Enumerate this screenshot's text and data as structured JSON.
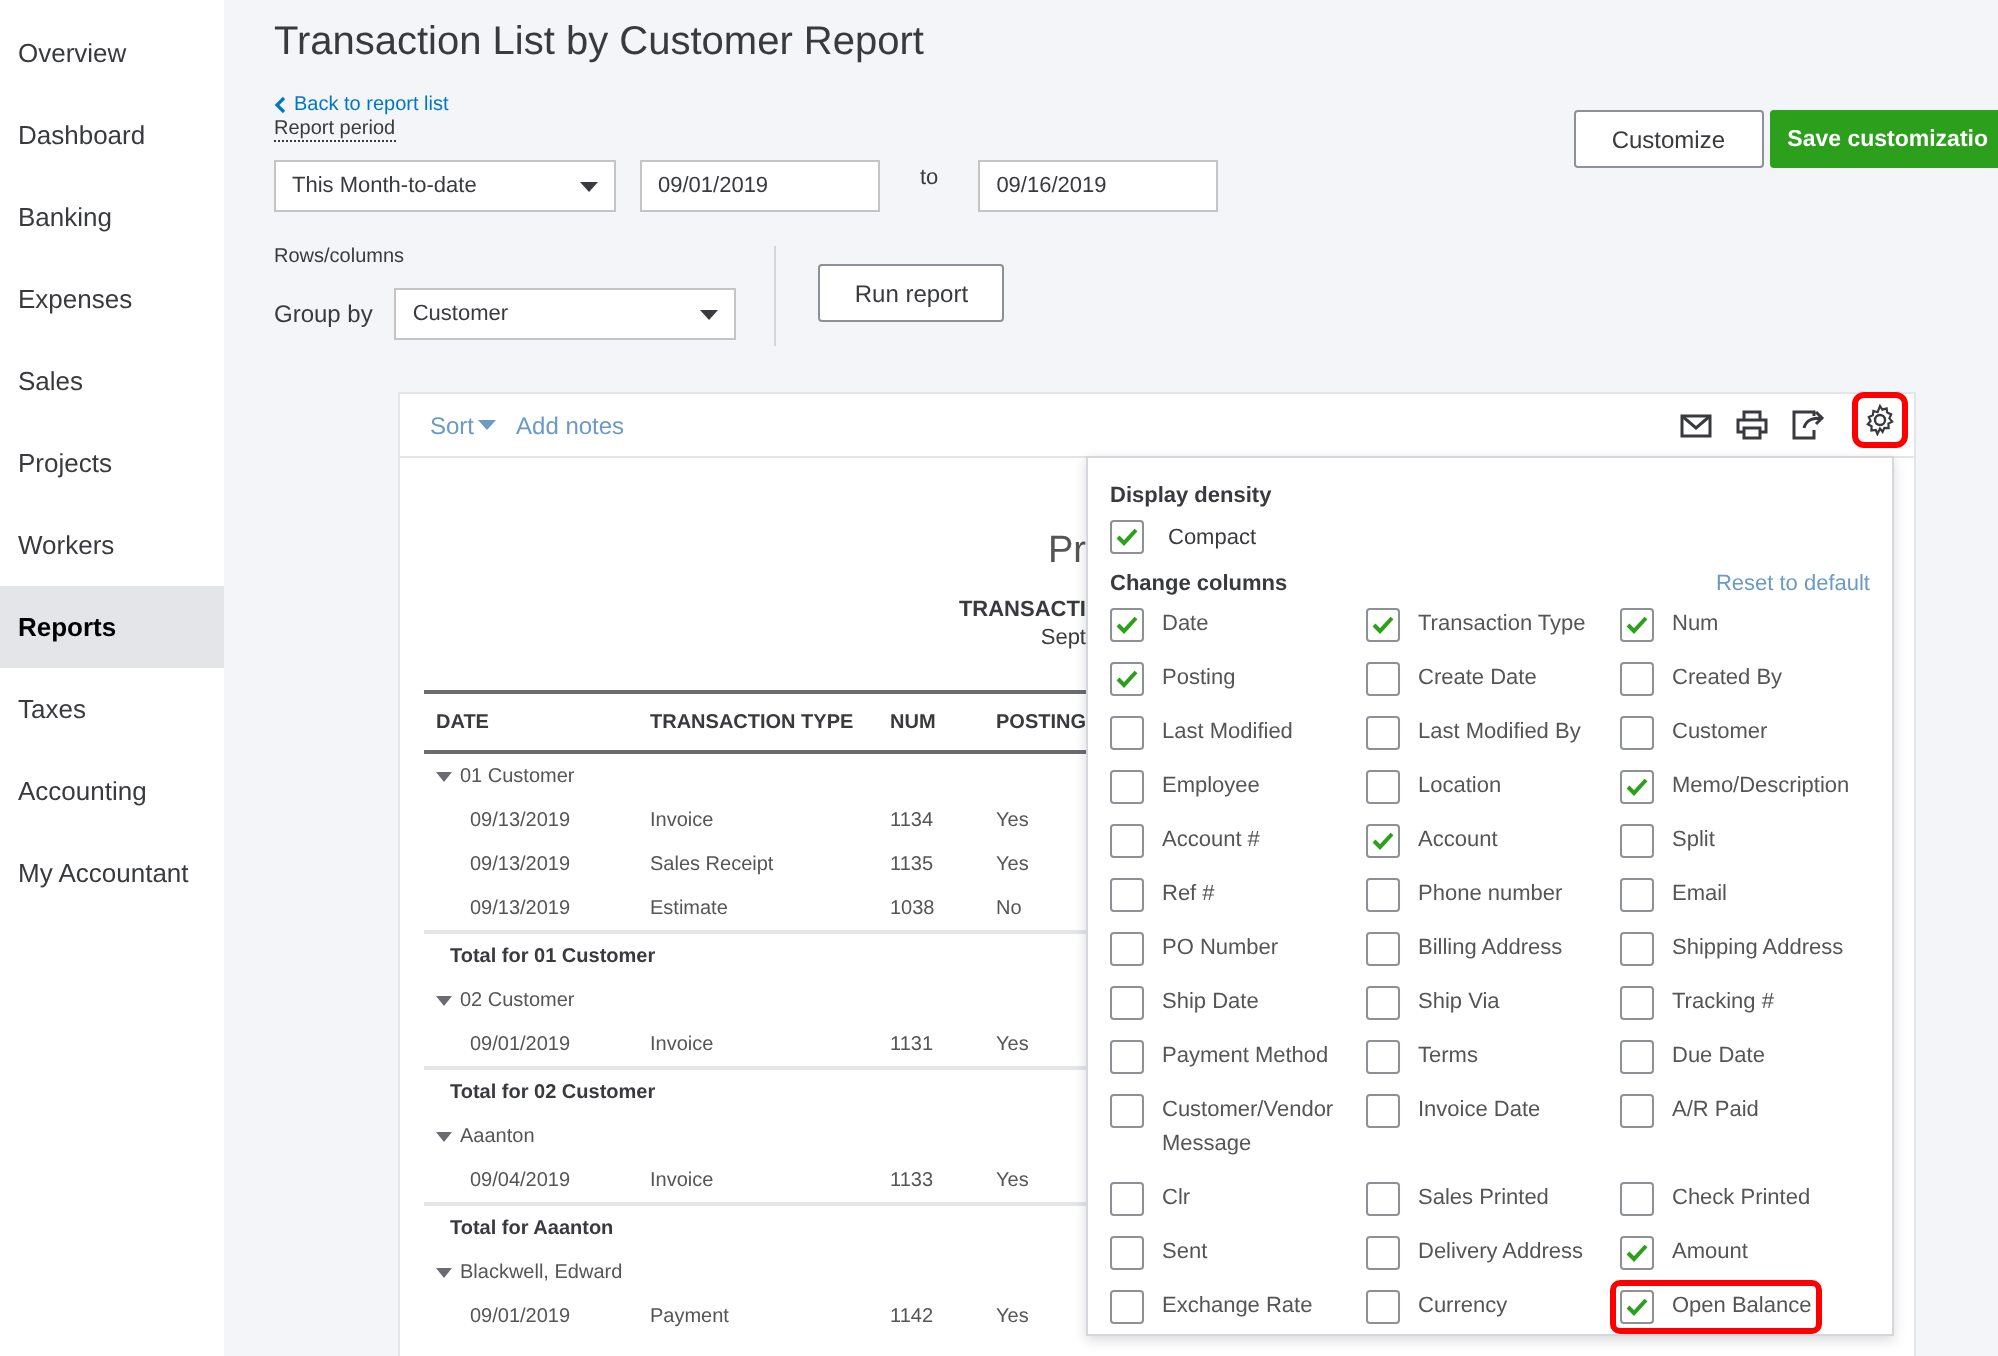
{
  "sidebar": {
    "items": [
      {
        "label": "Overview",
        "selected": false
      },
      {
        "label": "Dashboard",
        "selected": false
      },
      {
        "label": "Banking",
        "selected": false
      },
      {
        "label": "Expenses",
        "selected": false
      },
      {
        "label": "Sales",
        "selected": false
      },
      {
        "label": "Projects",
        "selected": false
      },
      {
        "label": "Workers",
        "selected": false
      },
      {
        "label": "Reports",
        "selected": true
      },
      {
        "label": "Taxes",
        "selected": false
      },
      {
        "label": "Accounting",
        "selected": false
      },
      {
        "label": "My Accountant",
        "selected": false
      }
    ]
  },
  "header": {
    "title": "Transaction List by Customer Report",
    "back_link": "Back to report list",
    "period_label": "Report period",
    "period": {
      "value": "This Month-to-date"
    },
    "from": {
      "value": "09/01/2019"
    },
    "to_label": "to",
    "to": {
      "value": "09/16/2019"
    },
    "rows_columns_label": "Rows/columns",
    "group_by_label": "Group by",
    "group_by": {
      "value": "Customer"
    },
    "run_button": "Run report",
    "customize_button": "Customize",
    "save_button": "Save customizatio"
  },
  "toolbar": {
    "sort": "Sort",
    "add_notes": "Add notes",
    "settings_highlighted": true
  },
  "report": {
    "company": "Pr",
    "title": "TRANSACTI",
    "period": "Sept",
    "columns": [
      "DATE",
      "TRANSACTION TYPE",
      "NUM",
      "POSTING"
    ],
    "groups": [
      {
        "name": "01 Customer",
        "expanded": true,
        "rows": [
          [
            "09/13/2019",
            "Invoice",
            "1134",
            "Yes"
          ],
          [
            "09/13/2019",
            "Sales Receipt",
            "1135",
            "Yes"
          ],
          [
            "09/13/2019",
            "Estimate",
            "1038",
            "No"
          ]
        ],
        "total": "Total for 01 Customer"
      },
      {
        "name": "02 Customer",
        "expanded": true,
        "rows": [
          [
            "09/01/2019",
            "Invoice",
            "1131",
            "Yes"
          ]
        ],
        "total": "Total for 02 Customer"
      },
      {
        "name": "Aaanton",
        "expanded": true,
        "rows": [
          [
            "09/04/2019",
            "Invoice",
            "1133",
            "Yes"
          ]
        ],
        "total": "Total for Aaanton"
      },
      {
        "name": "Blackwell, Edward",
        "expanded": true,
        "rows": [
          [
            "09/01/2019",
            "Payment",
            "1142",
            "Yes"
          ]
        ]
      }
    ]
  },
  "settings_panel": {
    "density_heading": "Display density",
    "compact": {
      "label": "Compact",
      "checked": true
    },
    "columns_heading": "Change columns",
    "reset_link": "Reset to default",
    "columns": [
      {
        "label": "Date",
        "checked": true,
        "highlighted": false
      },
      {
        "label": "Transaction Type",
        "checked": true,
        "highlighted": false
      },
      {
        "label": "Num",
        "checked": true,
        "highlighted": false
      },
      {
        "label": "Posting",
        "checked": true,
        "highlighted": false
      },
      {
        "label": "Create Date",
        "checked": false,
        "highlighted": false
      },
      {
        "label": "Created By",
        "checked": false,
        "highlighted": false
      },
      {
        "label": "Last Modified",
        "checked": false,
        "highlighted": false
      },
      {
        "label": "Last Modified By",
        "checked": false,
        "highlighted": false
      },
      {
        "label": "Customer",
        "checked": false,
        "highlighted": false
      },
      {
        "label": "Employee",
        "checked": false,
        "highlighted": false
      },
      {
        "label": "Location",
        "checked": false,
        "highlighted": false
      },
      {
        "label": "Memo/Description",
        "checked": true,
        "highlighted": false
      },
      {
        "label": "Account #",
        "checked": false,
        "highlighted": false
      },
      {
        "label": "Account",
        "checked": true,
        "highlighted": false
      },
      {
        "label": "Split",
        "checked": false,
        "highlighted": false
      },
      {
        "label": "Ref #",
        "checked": false,
        "highlighted": false
      },
      {
        "label": "Phone number",
        "checked": false,
        "highlighted": false
      },
      {
        "label": "Email",
        "checked": false,
        "highlighted": false
      },
      {
        "label": "PO Number",
        "checked": false,
        "highlighted": false
      },
      {
        "label": "Billing Address",
        "checked": false,
        "highlighted": false
      },
      {
        "label": "Shipping Address",
        "checked": false,
        "highlighted": false
      },
      {
        "label": "Ship Date",
        "checked": false,
        "highlighted": false
      },
      {
        "label": "Ship Via",
        "checked": false,
        "highlighted": false
      },
      {
        "label": "Tracking #",
        "checked": false,
        "highlighted": false
      },
      {
        "label": "Payment Method",
        "checked": false,
        "highlighted": false
      },
      {
        "label": "Terms",
        "checked": false,
        "highlighted": false
      },
      {
        "label": "Due Date",
        "checked": false,
        "highlighted": false
      },
      {
        "label": "Customer/Vendor Message",
        "checked": false,
        "highlighted": false
      },
      {
        "label": "Invoice Date",
        "checked": false,
        "highlighted": false
      },
      {
        "label": "A/R Paid",
        "checked": false,
        "highlighted": false
      },
      {
        "label": "Clr",
        "checked": false,
        "highlighted": false
      },
      {
        "label": "Sales Printed",
        "checked": false,
        "highlighted": false
      },
      {
        "label": "Check Printed",
        "checked": false,
        "highlighted": false
      },
      {
        "label": "Sent",
        "checked": false,
        "highlighted": false
      },
      {
        "label": "Delivery Address",
        "checked": false,
        "highlighted": false
      },
      {
        "label": "Amount",
        "checked": true,
        "highlighted": false
      },
      {
        "label": "Exchange Rate",
        "checked": false,
        "highlighted": false
      },
      {
        "label": "Currency",
        "checked": false,
        "highlighted": false
      },
      {
        "label": "Open Balance",
        "checked": true,
        "highlighted": true
      }
    ]
  }
}
